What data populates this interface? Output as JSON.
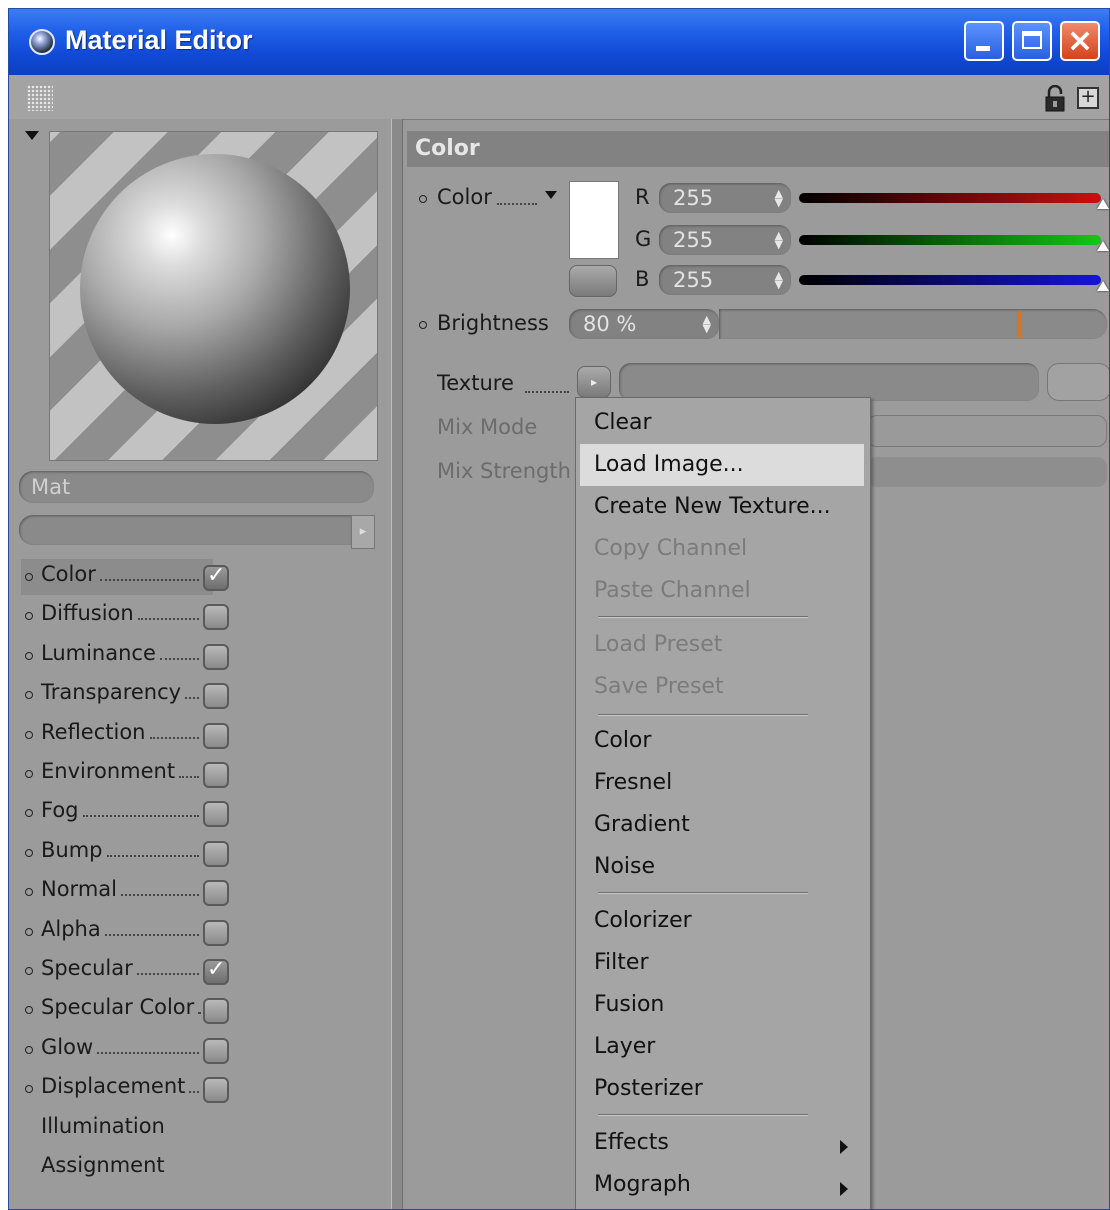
{
  "window": {
    "title": "Material Editor"
  },
  "material": {
    "name": "Mat"
  },
  "channels": [
    {
      "label": "Color",
      "checked": true
    },
    {
      "label": "Diffusion",
      "checked": false
    },
    {
      "label": "Luminance",
      "checked": false
    },
    {
      "label": "Transparency",
      "checked": false
    },
    {
      "label": "Reflection",
      "checked": false
    },
    {
      "label": "Environment",
      "checked": false
    },
    {
      "label": "Fog",
      "checked": false
    },
    {
      "label": "Bump",
      "checked": false
    },
    {
      "label": "Normal",
      "checked": false
    },
    {
      "label": "Alpha",
      "checked": false
    },
    {
      "label": "Specular",
      "checked": true
    },
    {
      "label": "Specular Color",
      "checked": false
    },
    {
      "label": "Glow",
      "checked": false
    },
    {
      "label": "Displacement",
      "checked": false
    }
  ],
  "extra_channels": [
    "Illumination",
    "Assignment"
  ],
  "section": {
    "title": "Color"
  },
  "color": {
    "label": "Color",
    "r_label": "R",
    "r": "255",
    "g_label": "G",
    "g": "255",
    "b_label": "B",
    "b": "255",
    "swatch": "#ffffff"
  },
  "brightness": {
    "label": "Brightness",
    "value": "80 %",
    "level": 0.8
  },
  "texture": {
    "label": "Texture"
  },
  "mix_mode": {
    "label": "Mix Mode"
  },
  "mix_strength": {
    "label": "Mix Strength"
  },
  "menu": {
    "items": [
      {
        "label": "Clear",
        "enabled": true
      },
      {
        "label": "Load Image...",
        "enabled": true,
        "highlighted": true
      },
      {
        "label": "Create New Texture...",
        "enabled": true
      },
      {
        "label": "Copy Channel",
        "enabled": false
      },
      {
        "label": "Paste Channel",
        "enabled": false
      },
      {
        "label": "Load Preset",
        "enabled": false
      },
      {
        "label": "Save Preset",
        "enabled": false
      },
      {
        "label": "Color",
        "enabled": true
      },
      {
        "label": "Fresnel",
        "enabled": true
      },
      {
        "label": "Gradient",
        "enabled": true
      },
      {
        "label": "Noise",
        "enabled": true
      },
      {
        "label": "Colorizer",
        "enabled": true
      },
      {
        "label": "Filter",
        "enabled": true
      },
      {
        "label": "Fusion",
        "enabled": true
      },
      {
        "label": "Layer",
        "enabled": true
      },
      {
        "label": "Posterizer",
        "enabled": true
      },
      {
        "label": "Effects",
        "enabled": true,
        "submenu": true
      },
      {
        "label": "Mograph",
        "enabled": true,
        "submenu": true
      }
    ]
  },
  "colors": {
    "titlebar": "#1f5fe8",
    "panel": "#9b9b9b",
    "red_bar": "#c81010",
    "green_bar": "#14c814",
    "blue_bar": "#1414d8",
    "brightness_marker": "#d0782a"
  }
}
